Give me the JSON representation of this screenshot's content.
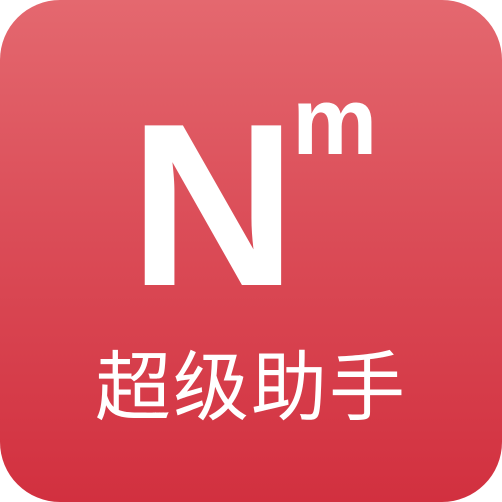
{
  "logo": {
    "main_letter": "N",
    "superscript": "m",
    "caption": "超级助手"
  },
  "colors": {
    "gradient_top": "#e4686f",
    "gradient_bottom": "#d2303f",
    "foreground": "#ffffff"
  }
}
